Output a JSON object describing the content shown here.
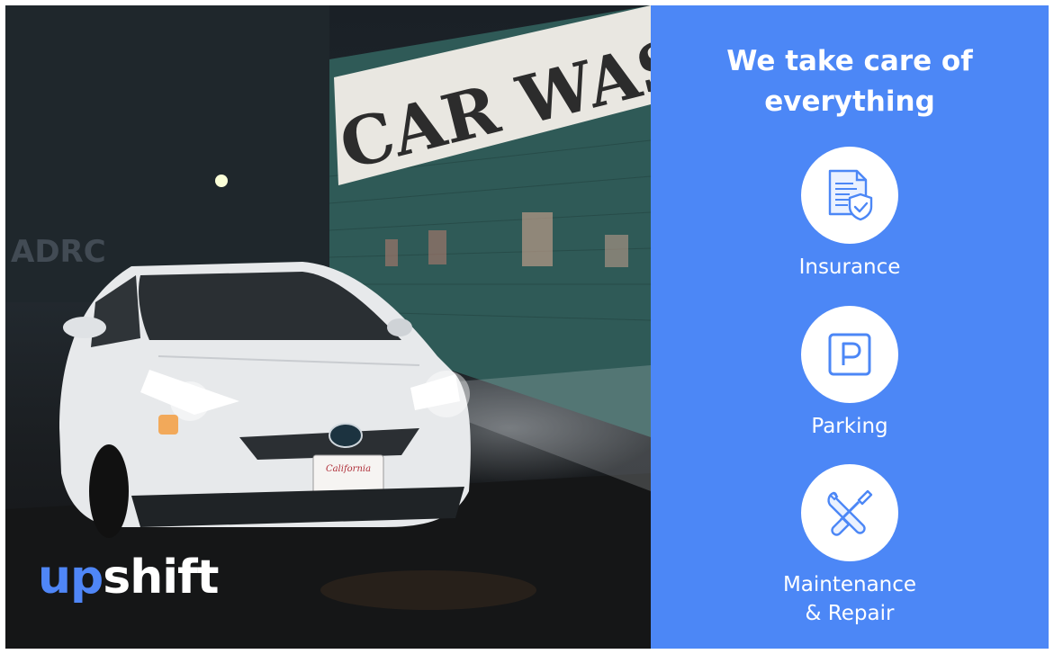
{
  "photo": {
    "sign_text": "CAR WAS",
    "plate_text": "California"
  },
  "brand": {
    "up": "up",
    "shift": "shift"
  },
  "panel": {
    "headline_line1": "We take care of",
    "headline_line2": "everything",
    "features": [
      {
        "label_line1": "Insurance",
        "label_line2": "",
        "icon": "insurance-document-shield-icon"
      },
      {
        "label_line1": "Parking",
        "label_line2": "",
        "icon": "parking-sign-icon"
      },
      {
        "label_line1": "Maintenance",
        "label_line2": "& Repair",
        "icon": "wrench-screwdriver-icon"
      }
    ],
    "colors": {
      "panel_blue": "#4c87f6",
      "brand_blue": "#4f86f7",
      "white": "#ffffff"
    }
  }
}
